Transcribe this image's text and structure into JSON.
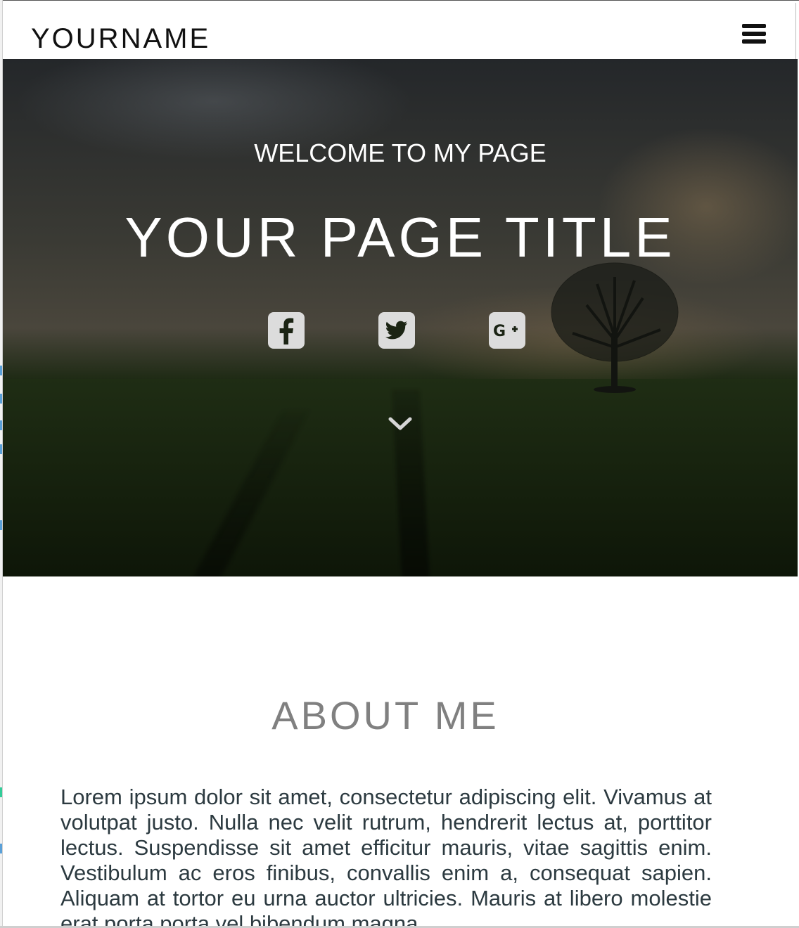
{
  "navbar": {
    "brand": "YOURNAME",
    "menu_icon": "hamburger-menu-icon"
  },
  "hero": {
    "welcome": "WELCOME TO MY PAGE",
    "title": "YOUR PAGE TITLE",
    "social": [
      {
        "name": "facebook",
        "icon": "facebook-square-icon"
      },
      {
        "name": "twitter",
        "icon": "twitter-square-icon"
      },
      {
        "name": "google-plus",
        "icon": "google-plus-square-icon"
      }
    ],
    "scroll_icon": "chevron-down-icon"
  },
  "about": {
    "title": "ABOUT ME",
    "text": "Lorem ipsum dolor sit amet, consectetur adipiscing elit. Vivamus at volutpat justo. Nulla nec velit rutrum, hendrerit lectus at, porttitor lectus. Suspendisse sit amet efficitur mauris, vitae sagittis enim. Vestibulum ac eros finibus, convallis enim a, consequat sapien. Aliquam at tortor eu urna auctor ultricies. Mauris at libero molestie erat porta porta vel bibendum magna."
  },
  "colors": {
    "text_dark": "#111111",
    "heading_gray": "#808080",
    "body_text": "#2c3a40",
    "icon_bg": "#dcdcdc"
  }
}
